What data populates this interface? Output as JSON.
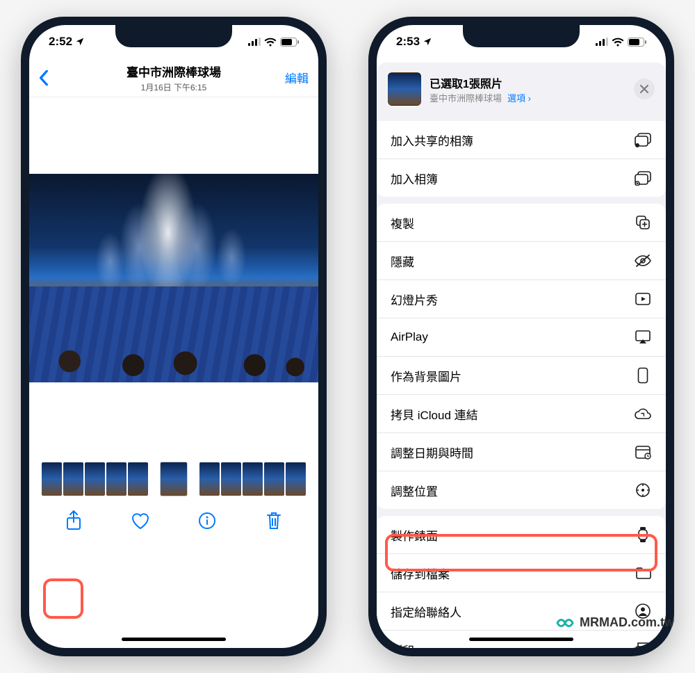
{
  "left": {
    "status": {
      "time": "2:52",
      "loc_arrow": "➤"
    },
    "nav": {
      "title": "臺中市洲際棒球場",
      "subtitle": "1月16日 下午6:15",
      "edit": "編輯"
    }
  },
  "right": {
    "status": {
      "time": "2:53"
    },
    "sheet": {
      "title": "已選取1張照片",
      "subtitle_location": "臺中市洲際棒球場",
      "options_label": "選項",
      "chevron": "›"
    },
    "actions": {
      "groupA": [
        {
          "label": "加入共享的相簿",
          "icon": "shared-album-icon"
        },
        {
          "label": "加入相簿",
          "icon": "add-album-icon"
        }
      ],
      "groupB": [
        {
          "label": "複製",
          "icon": "copy-icon"
        },
        {
          "label": "隱藏",
          "icon": "hide-icon"
        },
        {
          "label": "幻燈片秀",
          "icon": "slideshow-icon"
        },
        {
          "label": "AirPlay",
          "icon": "airplay-icon"
        },
        {
          "label": "作為背景圖片",
          "icon": "wallpaper-icon"
        },
        {
          "label": "拷貝 iCloud 連結",
          "icon": "icloud-link-icon"
        },
        {
          "label": "調整日期與時間",
          "icon": "calendar-icon"
        },
        {
          "label": "調整位置",
          "icon": "location-icon"
        }
      ],
      "groupC": [
        {
          "label": "製作錶面",
          "icon": "watch-face-icon"
        },
        {
          "label": "儲存到檔案",
          "icon": "folder-icon"
        },
        {
          "label": "指定給聯絡人",
          "icon": "contact-icon"
        },
        {
          "label": "列印",
          "icon": "print-icon"
        }
      ]
    }
  },
  "watermark": "MRMAD.com.tw",
  "colors": {
    "accent": "#007aff",
    "highlight": "#ff5a4a"
  }
}
